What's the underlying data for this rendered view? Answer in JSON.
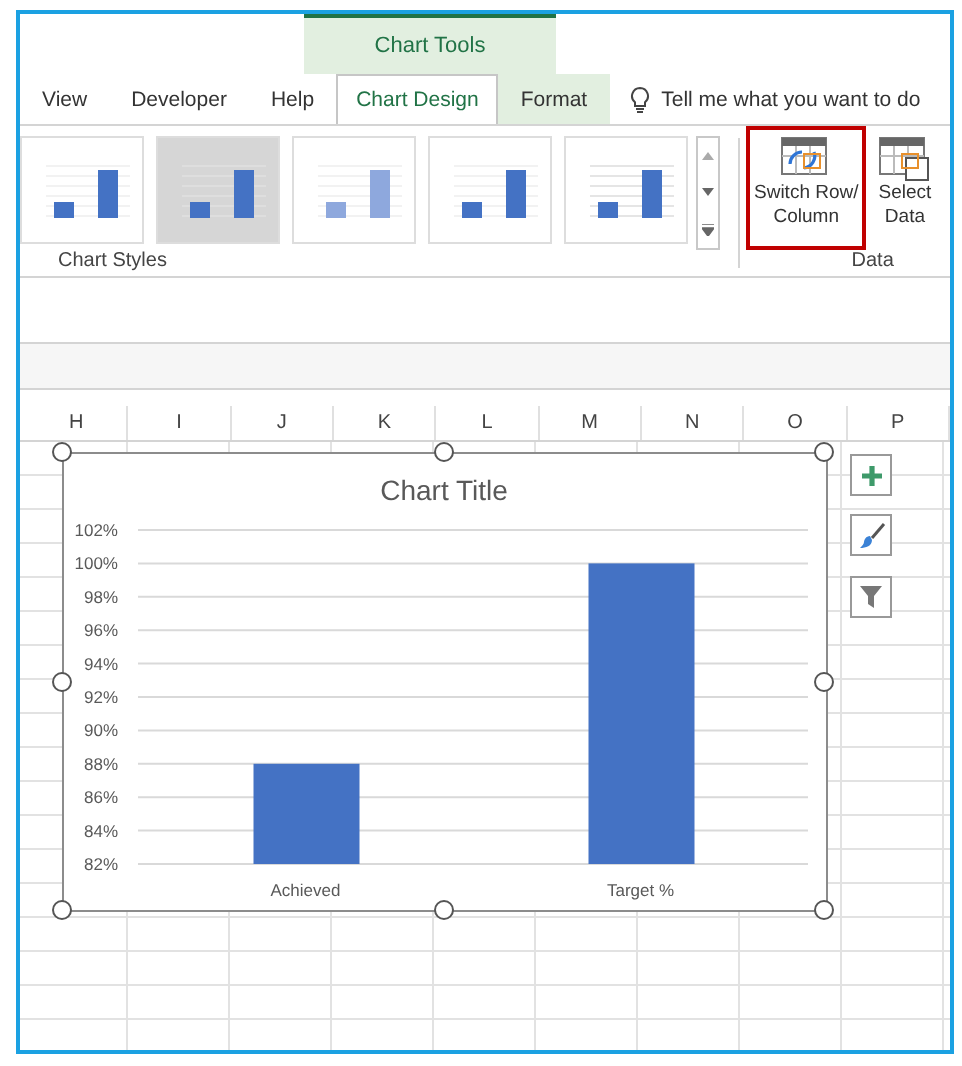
{
  "context_tab": {
    "label": "Chart Tools"
  },
  "tabs": [
    {
      "label": "View",
      "selected": false
    },
    {
      "label": "Developer",
      "selected": false
    },
    {
      "label": "Help",
      "selected": false
    },
    {
      "label": "Chart Design",
      "selected": true
    },
    {
      "label": "Format",
      "selected": false
    }
  ],
  "search": {
    "placeholder": "Tell me what you want to do"
  },
  "chart_styles": {
    "label": "Chart Styles",
    "thumbnails": [
      {
        "selected": false
      },
      {
        "selected": true
      },
      {
        "selected": false
      },
      {
        "selected": false
      },
      {
        "selected": false
      }
    ]
  },
  "data_group": {
    "label": "Data",
    "buttons": [
      {
        "label_lines": [
          "Switch Row/",
          "Column"
        ],
        "highlighted": true
      },
      {
        "label_lines": [
          "Select",
          "Data"
        ],
        "highlighted": false
      }
    ]
  },
  "columns": [
    "H",
    "I",
    "J",
    "K",
    "L",
    "M",
    "N",
    "O",
    "P"
  ],
  "chart": {
    "chart_data": {
      "type": "bar",
      "grid": true,
      "title": "Chart Title",
      "categories": [
        "Achieved",
        "Target %"
      ],
      "values": [
        0.88,
        1.0
      ],
      "ylim": [
        0.82,
        1.02
      ],
      "yticks": [
        {
          "value": 0.82,
          "label": "82%"
        },
        {
          "value": 0.84,
          "label": "84%"
        },
        {
          "value": 0.86,
          "label": "86%"
        },
        {
          "value": 0.88,
          "label": "88%"
        },
        {
          "value": 0.9,
          "label": "90%"
        },
        {
          "value": 0.92,
          "label": "92%"
        },
        {
          "value": 0.94,
          "label": "94%"
        },
        {
          "value": 0.96,
          "label": "96%"
        },
        {
          "value": 0.98,
          "label": "98%"
        },
        {
          "value": 1.0,
          "label": "100%"
        },
        {
          "value": 1.02,
          "label": "102%"
        }
      ]
    }
  }
}
